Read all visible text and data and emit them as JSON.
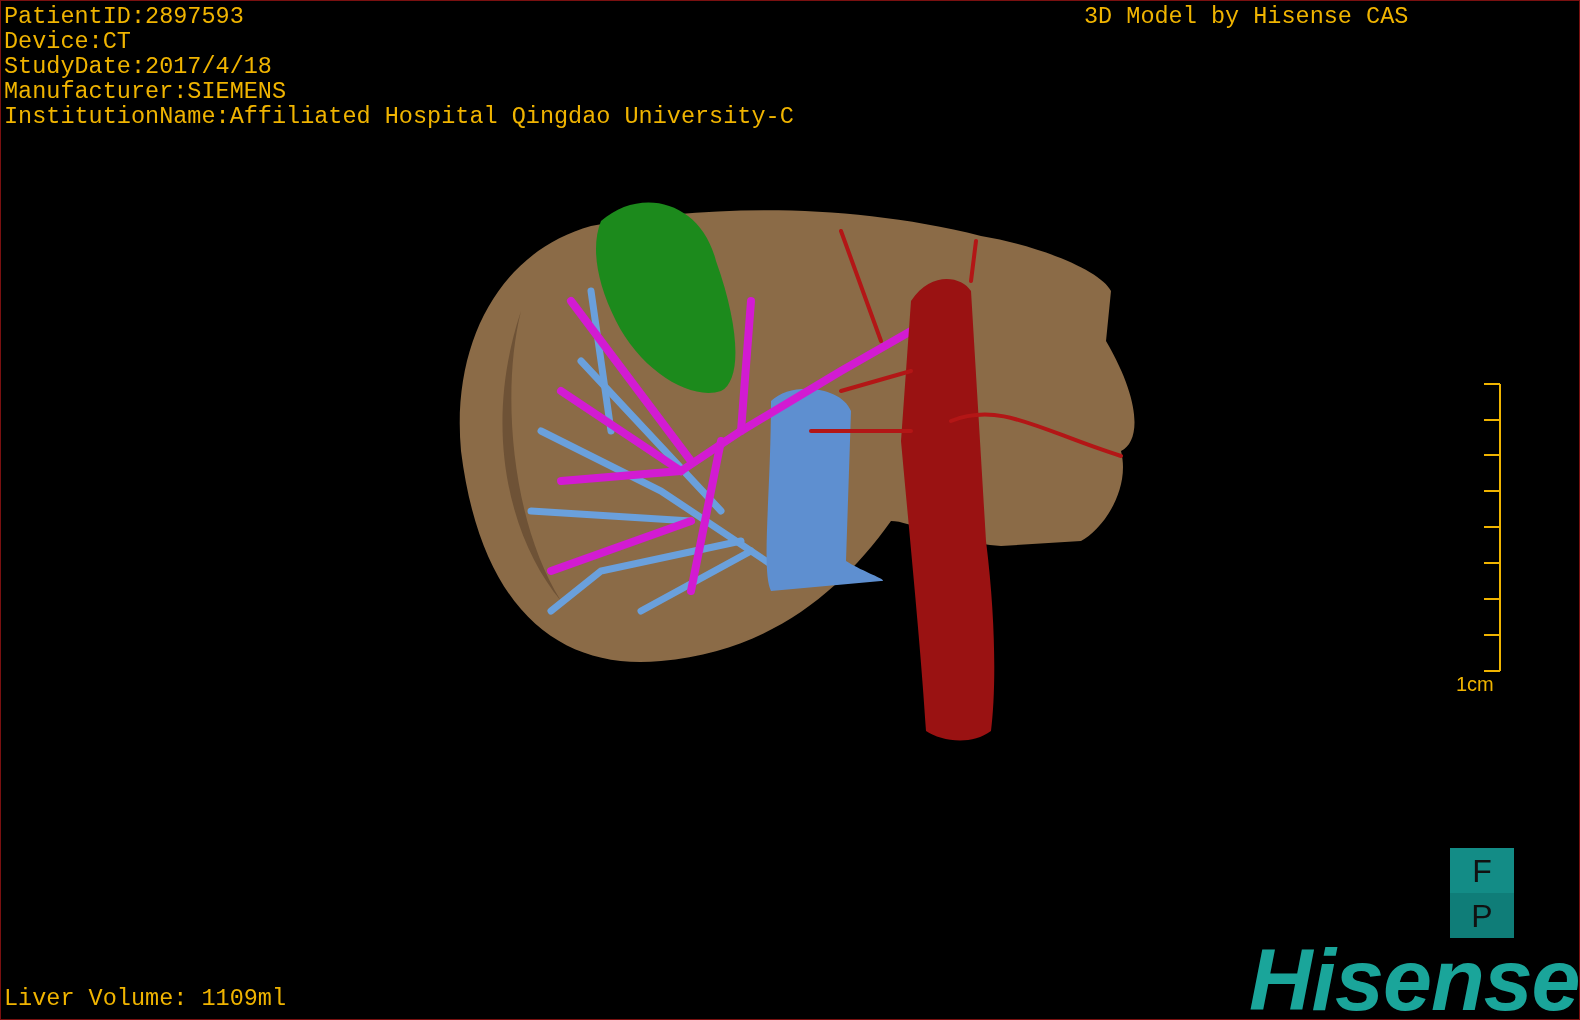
{
  "study_info": [
    "PatientID:2897593",
    "Device:CT",
    "StudyDate:2017/4/18",
    "Manufacturer:SIEMENS",
    "InstitutionName:Affiliated Hospital Qingdao University-C"
  ],
  "model_credit": "3D Model by Hisense CAS",
  "scale_bar": {
    "label": "1cm"
  },
  "orientation_cube": [
    "F",
    "P"
  ],
  "logo": "Hisense",
  "liver_volume": "Liver Volume: 1109ml"
}
